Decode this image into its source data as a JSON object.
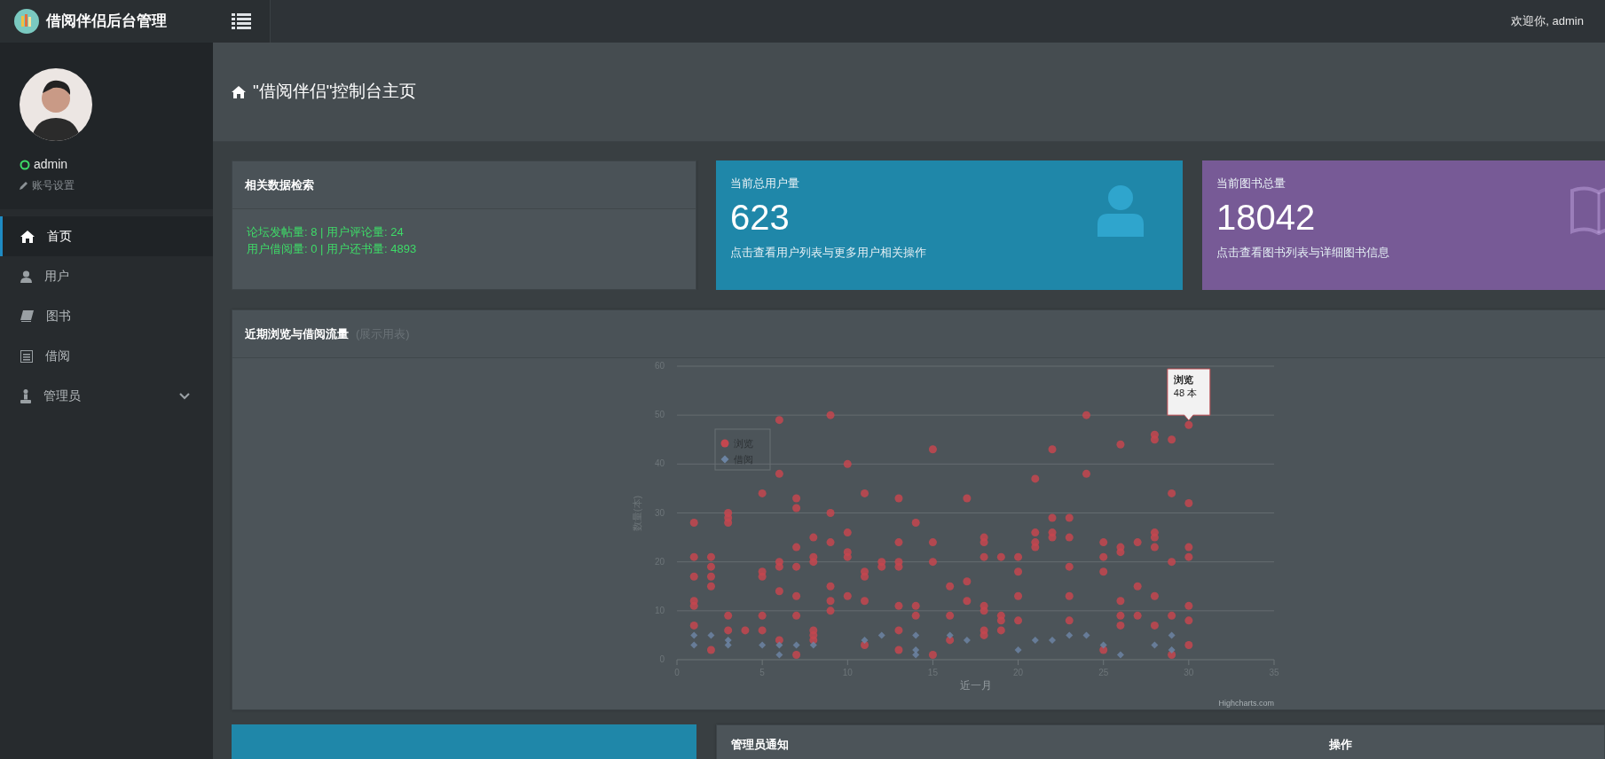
{
  "header": {
    "brand": "借阅伴侣后台管理",
    "welcome": "欢迎你, admin"
  },
  "sidebar": {
    "user": {
      "name": "admin",
      "online": true,
      "settings": "账号设置"
    },
    "items": [
      {
        "label": "首页",
        "kind": "home",
        "selected": true,
        "expandable": false
      },
      {
        "label": "用户",
        "kind": "user",
        "selected": false,
        "expandable": false
      },
      {
        "label": "图书",
        "kind": "book",
        "selected": false,
        "expandable": false
      },
      {
        "label": "借阅",
        "kind": "list",
        "selected": false,
        "expandable": false
      },
      {
        "label": "管理员",
        "kind": "admin",
        "selected": false,
        "expandable": true
      }
    ]
  },
  "page_title": "\"借阅伴侣\"控制台主页",
  "search_panel": {
    "title": "相关数据检索",
    "lines": [
      "论坛发帖量: 8 | 用户评论量: 24",
      "用户借阅量: 0 | 用户还书量: 4893"
    ]
  },
  "stat_cards": [
    {
      "label": "当前总用户量",
      "value": "623",
      "link": "点击查看用户列表与更多用户相关操作",
      "kind": "user",
      "color": "#1f87a9"
    },
    {
      "label": "当前图书总量",
      "value": "18042",
      "link": "点击查看图书列表与详细图书信息",
      "kind": "book",
      "color": "#775a96"
    }
  ],
  "chart_panel": {
    "title": "近期浏览与借阅流量",
    "subtitle": "(展示用表)",
    "chart_data": {
      "type": "scatter",
      "grid": true,
      "legend": true,
      "xlabel": "近一月",
      "ylabel": "数量(本)",
      "xlim": [
        0,
        35
      ],
      "ylim": [
        0,
        60
      ],
      "xticks": [
        0,
        5,
        10,
        15,
        20,
        25,
        30,
        35
      ],
      "yticks": [
        0,
        10,
        20,
        30,
        40,
        50,
        60
      ],
      "series": [
        {
          "name": "浏览",
          "color": "#c4474f",
          "x": [
            1,
            1,
            1,
            1,
            1,
            1,
            2,
            2,
            2,
            2,
            2,
            3,
            3,
            3,
            3,
            3,
            4,
            5,
            5,
            5,
            5,
            5,
            6,
            6,
            6,
            6,
            6,
            6,
            7,
            7,
            7,
            7,
            7,
            7,
            7,
            8,
            8,
            8,
            8,
            8,
            8,
            9,
            9,
            9,
            9,
            9,
            9,
            10,
            10,
            10,
            10,
            10,
            11,
            11,
            11,
            11,
            11,
            12,
            12,
            13,
            13,
            13,
            13,
            13,
            13,
            13,
            14,
            14,
            14,
            15,
            15,
            15,
            15,
            16,
            16,
            16,
            17,
            17,
            17,
            18,
            18,
            18,
            18,
            18,
            18,
            18,
            19,
            19,
            19,
            19,
            20,
            20,
            20,
            20,
            21,
            21,
            21,
            21,
            22,
            22,
            22,
            22,
            23,
            23,
            23,
            23,
            23,
            24,
            24,
            25,
            25,
            25,
            25,
            26,
            26,
            26,
            26,
            26,
            26,
            27,
            27,
            27,
            28,
            28,
            28,
            28,
            28,
            28,
            28,
            29,
            29,
            29,
            29,
            29,
            30,
            30,
            30,
            30,
            30,
            30,
            30
          ],
          "values": [
            28,
            21,
            17,
            12,
            11,
            7,
            21,
            19,
            17,
            15,
            2,
            30,
            29,
            28,
            9,
            6,
            6,
            34,
            18,
            17,
            9,
            6,
            49,
            38,
            20,
            19,
            14,
            4,
            33,
            31,
            23,
            19,
            13,
            9,
            1,
            25,
            21,
            20,
            6,
            5,
            4,
            50,
            30,
            24,
            15,
            12,
            10,
            40,
            26,
            22,
            21,
            13,
            34,
            18,
            17,
            12,
            3,
            20,
            19,
            33,
            24,
            20,
            19,
            11,
            6,
            2,
            28,
            11,
            9,
            43,
            24,
            20,
            1,
            15,
            9,
            4,
            33,
            16,
            12,
            25,
            24,
            21,
            11,
            10,
            6,
            5,
            21,
            9,
            8,
            6,
            21,
            18,
            13,
            8,
            37,
            26,
            24,
            23,
            43,
            29,
            26,
            25,
            29,
            25,
            19,
            13,
            8,
            50,
            38,
            24,
            21,
            18,
            2,
            44,
            23,
            22,
            12,
            9,
            7,
            24,
            15,
            9,
            46,
            45,
            26,
            25,
            23,
            13,
            7,
            45,
            34,
            20,
            9,
            1,
            48,
            32,
            23,
            21,
            11,
            8,
            3
          ]
        },
        {
          "name": "借阅",
          "color": "#6c84a3",
          "x": [
            1,
            1,
            2,
            3,
            3,
            5,
            6,
            6,
            7,
            8,
            11,
            12,
            14,
            14,
            14,
            16,
            17,
            20,
            21,
            22,
            23,
            24,
            25,
            26,
            28,
            29,
            29
          ],
          "values": [
            5,
            3,
            5,
            4,
            3,
            3,
            3,
            1,
            3,
            3,
            4,
            5,
            5,
            2,
            1,
            5,
            4,
            2,
            4,
            4,
            5,
            5,
            3,
            1,
            3,
            5,
            2
          ]
        }
      ]
    },
    "tooltip": {
      "title": "浏览",
      "value": "48 本"
    },
    "credit": "Highcharts.com"
  },
  "bottom_cards": [
    {
      "kind": "stat"
    },
    {
      "kind": "notice",
      "title": "管理员通知",
      "action": "操作"
    }
  ]
}
